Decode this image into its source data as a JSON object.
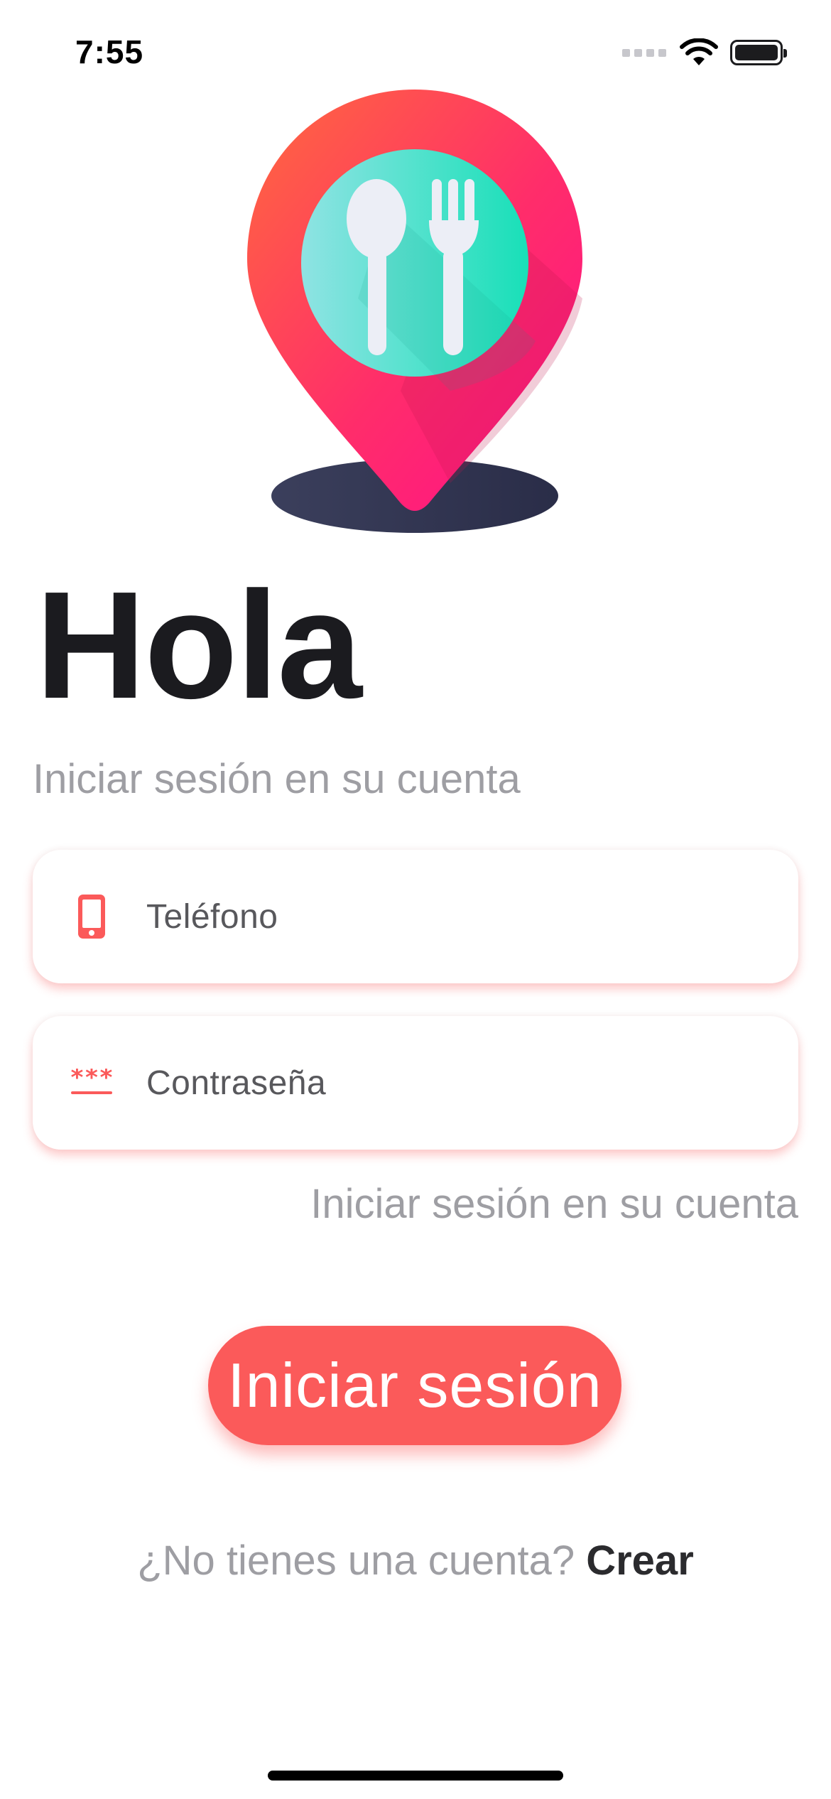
{
  "status_bar": {
    "time": "7:55"
  },
  "header": {
    "title": "Hola",
    "subtitle": "Iniciar sesión en su cuenta"
  },
  "form": {
    "phone": {
      "placeholder": "Teléfono",
      "icon": "phone-icon"
    },
    "password": {
      "placeholder": "Contraseña",
      "icon": "password-icon"
    },
    "forgot_link": "Iniciar sesión en su cuenta"
  },
  "actions": {
    "login_label": "Iniciar sesión",
    "signup_prompt": "¿No tienes una cuenta?",
    "signup_link": "Crear"
  },
  "colors": {
    "accent": "#fb5a5a",
    "pin_gradient_start": "#ff6a3d",
    "pin_gradient_end": "#ff1e7a",
    "plate": "#4fe0c8",
    "shadow_base": "#2e3150",
    "text_dark": "#1b1b1f",
    "text_muted": "#9e9ea3"
  }
}
